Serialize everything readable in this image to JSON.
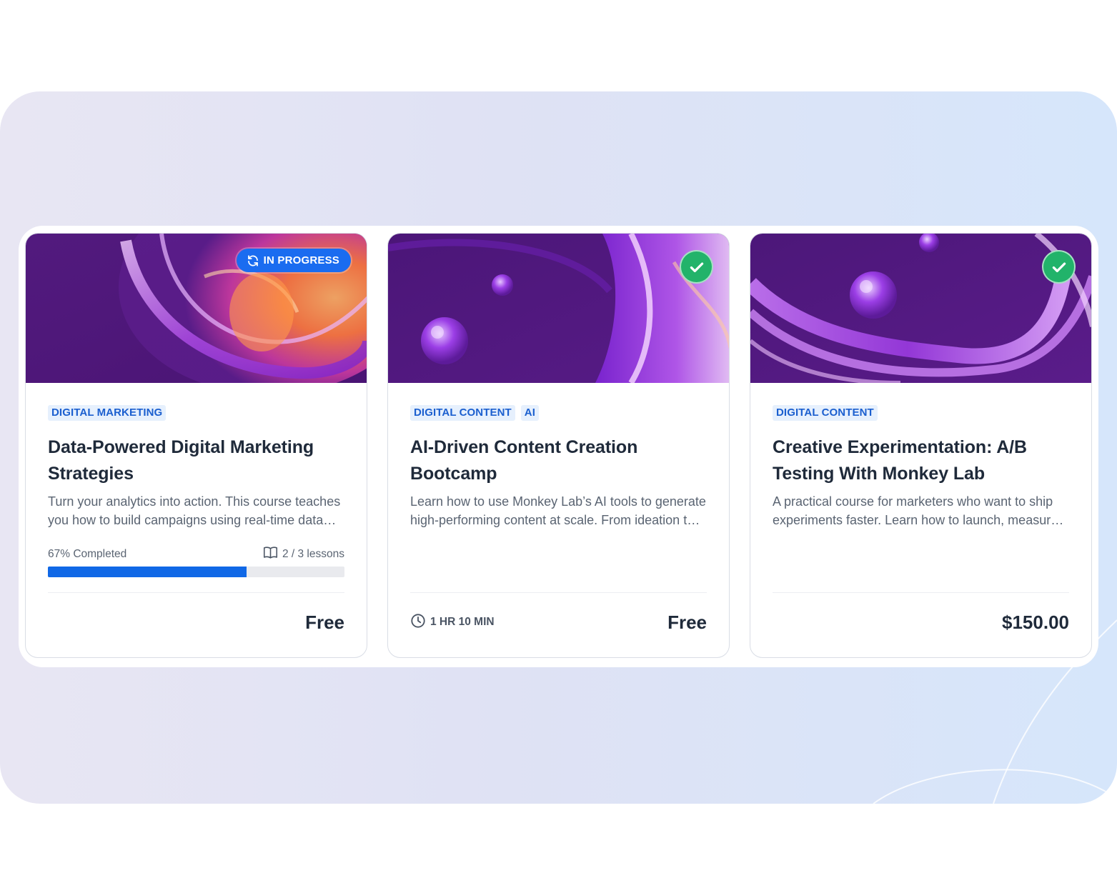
{
  "colors": {
    "accent": "#1068e6",
    "badge_blue": "#1a6cf0",
    "success_green": "#22b36a",
    "tag_bg": "#e6f0fd",
    "tag_text": "#1b5fcf"
  },
  "cards": [
    {
      "status": "in-progress",
      "status_label": "IN PROGRESS",
      "status_icon": "sync-icon",
      "tags": [
        "DIGITAL MARKETING"
      ],
      "title": "Data-Powered Digital Marketing Strategies",
      "description": "Turn your analytics into action. This course teaches you how to build campaigns using real-time data and insights.",
      "progress": {
        "label": "67% Completed",
        "percent": 67,
        "lessons": "2 / 3 lessons",
        "lessons_icon": "book-icon"
      },
      "price": "Free"
    },
    {
      "status": "completed",
      "status_icon": "check-icon",
      "tags": [
        "DIGITAL CONTENT",
        "AI"
      ],
      "title": "AI-Driven Content Creation Bootcamp",
      "description": "Learn how to use Monkey Lab’s AI tools to generate high-performing content at scale. From ideation to publishing.",
      "duration": "1 HR 10 MIN",
      "duration_icon": "clock-icon",
      "price": "Free"
    },
    {
      "status": "completed",
      "status_icon": "check-icon",
      "tags": [
        "DIGITAL CONTENT"
      ],
      "title": "Creative Experimentation: A/B Testing With Monkey Lab",
      "description": "A practical course for marketers who want to ship experiments faster. Learn how to launch, measure and iterate.",
      "price": "$150.00"
    }
  ]
}
